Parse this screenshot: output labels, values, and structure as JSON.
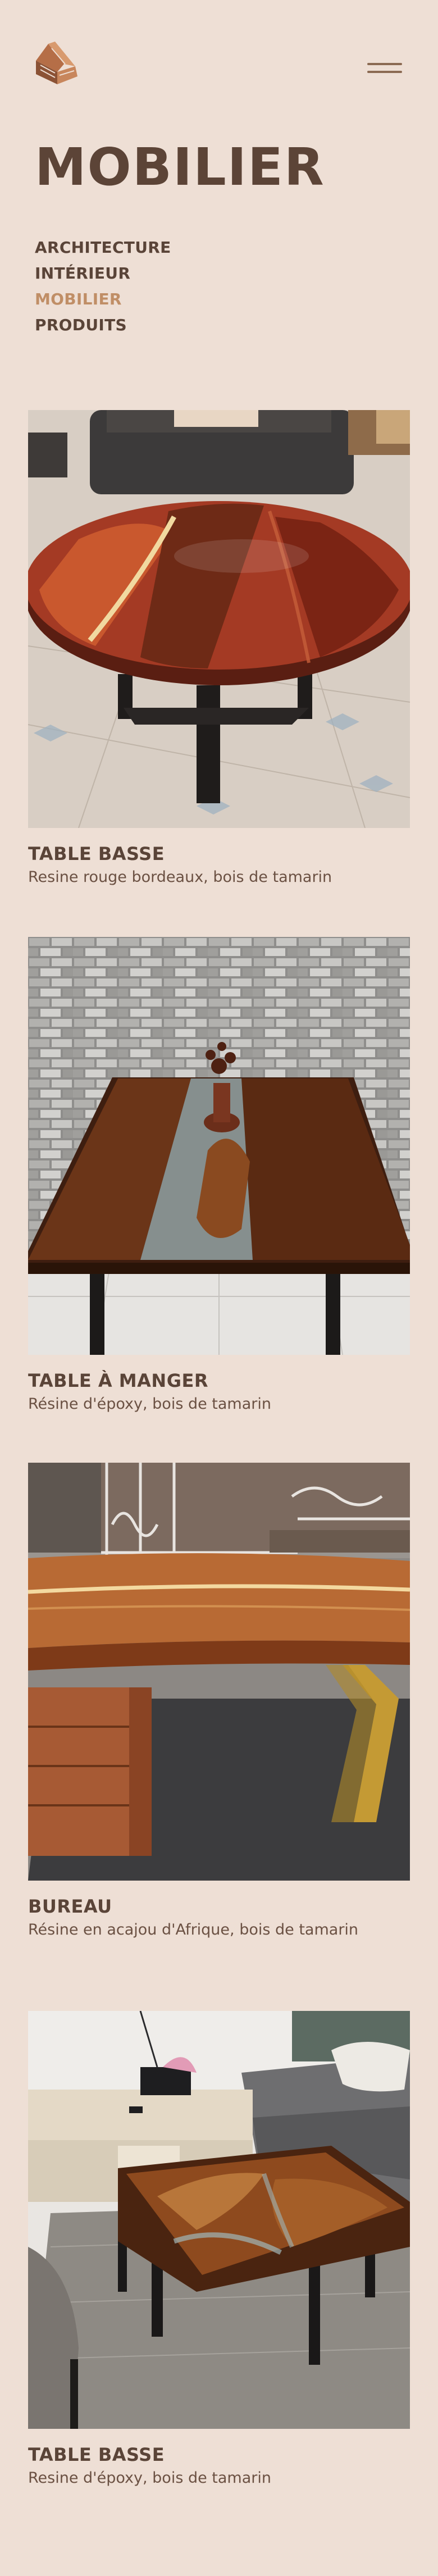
{
  "header": {
    "logo_icon": "house-logo-icon",
    "menu_icon": "hamburger-menu-icon"
  },
  "page": {
    "title": "MOBILIER"
  },
  "nav": {
    "items": [
      {
        "label": "ARCHITECTURE",
        "active": false
      },
      {
        "label": "INTÉRIEUR",
        "active": false
      },
      {
        "label": "MOBILIER",
        "active": true
      },
      {
        "label": "PRODUITS",
        "active": false
      }
    ]
  },
  "products": [
    {
      "title": "TABLE BASSE",
      "description": "Resine rouge bordeaux, bois de tamarin"
    },
    {
      "title": "TABLE À MANGER",
      "description": "Résine d'époxy, bois de tamarin"
    },
    {
      "title": "BUREAU",
      "description": "Résine en acajou d'Afrique, bois de tamarin"
    },
    {
      "title": "TABLE BASSE",
      "description": "Resine d'époxy, bois de tamarin"
    }
  ],
  "colors": {
    "background": "#EEDFD5",
    "text": "#5A4438",
    "active_nav": "#C08E66"
  }
}
